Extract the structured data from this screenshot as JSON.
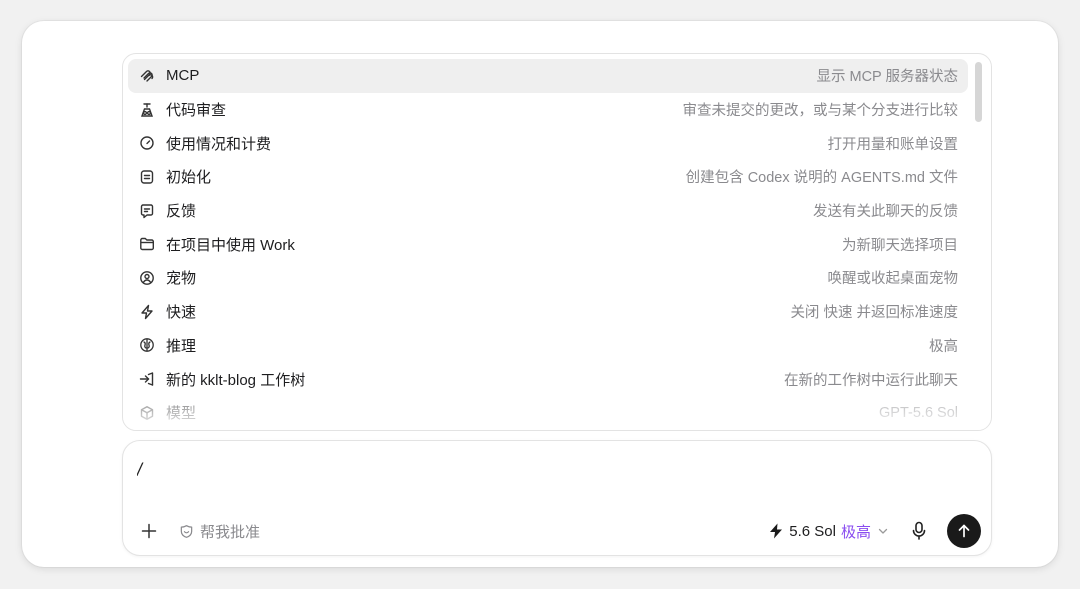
{
  "menu": {
    "items": [
      {
        "icon": "mcp-icon",
        "label": "MCP",
        "desc": "显示 MCP 服务器状态"
      },
      {
        "icon": "code-review-icon",
        "label": "代码审查",
        "desc": "审查未提交的更改，或与某个分支进行比较"
      },
      {
        "icon": "gauge-icon",
        "label": "使用情况和计费",
        "desc": "打开用量和账单设置"
      },
      {
        "icon": "document-icon",
        "label": "初始化",
        "desc": "创建包含 Codex 说明的 AGENTS.md 文件"
      },
      {
        "icon": "feedback-icon",
        "label": "反馈",
        "desc": "发送有关此聊天的反馈"
      },
      {
        "icon": "folder-icon",
        "label": "在项目中使用 Work",
        "desc": "为新聊天选择项目"
      },
      {
        "icon": "pet-icon",
        "label": "宠物",
        "desc": "唤醒或收起桌面宠物"
      },
      {
        "icon": "lightning-icon",
        "label": "快速",
        "desc": "关闭 快速 并返回标准速度"
      },
      {
        "icon": "brain-icon",
        "label": "推理",
        "desc": "极高"
      },
      {
        "icon": "worktree-icon",
        "label": "新的 kklt-blog 工作树",
        "desc": "在新的工作树中运行此聊天"
      },
      {
        "icon": "cube-icon",
        "label": "模型",
        "desc": "GPT-5.6 Sol"
      }
    ]
  },
  "composer": {
    "input_value": "/",
    "approve_label": "帮我批准",
    "model_label": "5.6 Sol",
    "reasoning_level": "极高"
  },
  "colors": {
    "accent_purple": "#8a4df0",
    "send_button": "#1a1a1a",
    "active_row": "#efefef"
  }
}
